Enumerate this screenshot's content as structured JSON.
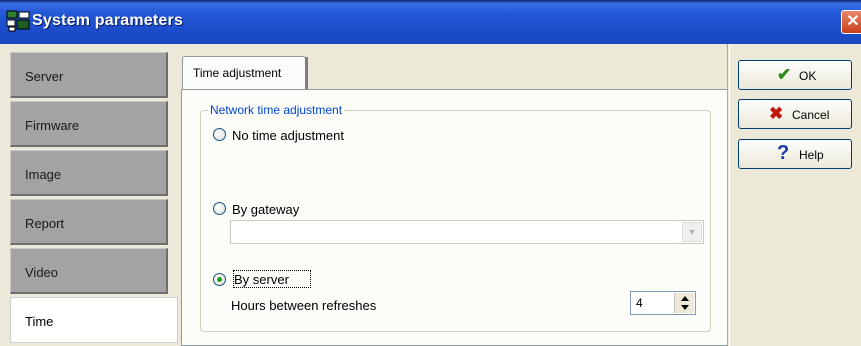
{
  "window": {
    "title": "System parameters",
    "close_glyph": "✕"
  },
  "sidebar": {
    "items": [
      {
        "label": "Server",
        "active": false
      },
      {
        "label": "Firmware",
        "active": false
      },
      {
        "label": "Image",
        "active": false
      },
      {
        "label": "Report",
        "active": false
      },
      {
        "label": "Video",
        "active": false
      },
      {
        "label": "Time",
        "active": true
      }
    ]
  },
  "tabs": [
    {
      "label": "Time adjustment",
      "selected": true
    }
  ],
  "group": {
    "legend": "Network time adjustment",
    "options": [
      {
        "label": "No time adjustment",
        "checked": false
      },
      {
        "label": "By gateway",
        "checked": false
      },
      {
        "label": "By server",
        "checked": true
      }
    ],
    "gateway_select": {
      "value": ""
    },
    "refresh": {
      "label": "Hours between refreshes",
      "value": "4"
    }
  },
  "buttons": {
    "ok": {
      "label": "OK",
      "icon": "check-icon",
      "color": "#2a8a1a"
    },
    "cancel": {
      "label": "Cancel",
      "icon": "x-icon",
      "color": "#c0180c"
    },
    "help": {
      "label": "Help",
      "icon": "question-icon",
      "color": "#1a3aa8"
    }
  },
  "colors": {
    "titlebar": "#2257d6",
    "legend": "#0046d5",
    "sidebar_inactive": "#a3a3a3"
  }
}
